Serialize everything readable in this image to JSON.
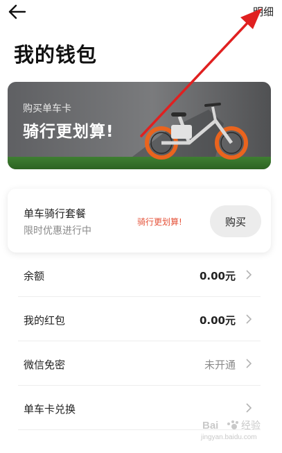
{
  "header": {
    "back_icon": "arrow-left-icon",
    "detail_label": "明细"
  },
  "page": {
    "title": "我的钱包"
  },
  "banner": {
    "subtitle": "购买单车卡",
    "headline": "骑行更划算!"
  },
  "package_card": {
    "title": "单车骑行套餐",
    "subtitle": "限时优惠进行中",
    "promo": "骑行更划算!",
    "buy_label": "购买",
    "promo_color": "#e5533a"
  },
  "list": {
    "items": [
      {
        "label": "余额",
        "value": "0.00元"
      },
      {
        "label": "我的红包",
        "value": "0.00元"
      },
      {
        "label": "微信免密",
        "value": "未开通"
      },
      {
        "label": "单车卡兑换",
        "value": ""
      }
    ]
  },
  "annotation": {
    "arrow_color": "#e02020"
  },
  "watermark": {
    "brand": "Bai 经验",
    "url": "jingyan.baidu.com"
  }
}
